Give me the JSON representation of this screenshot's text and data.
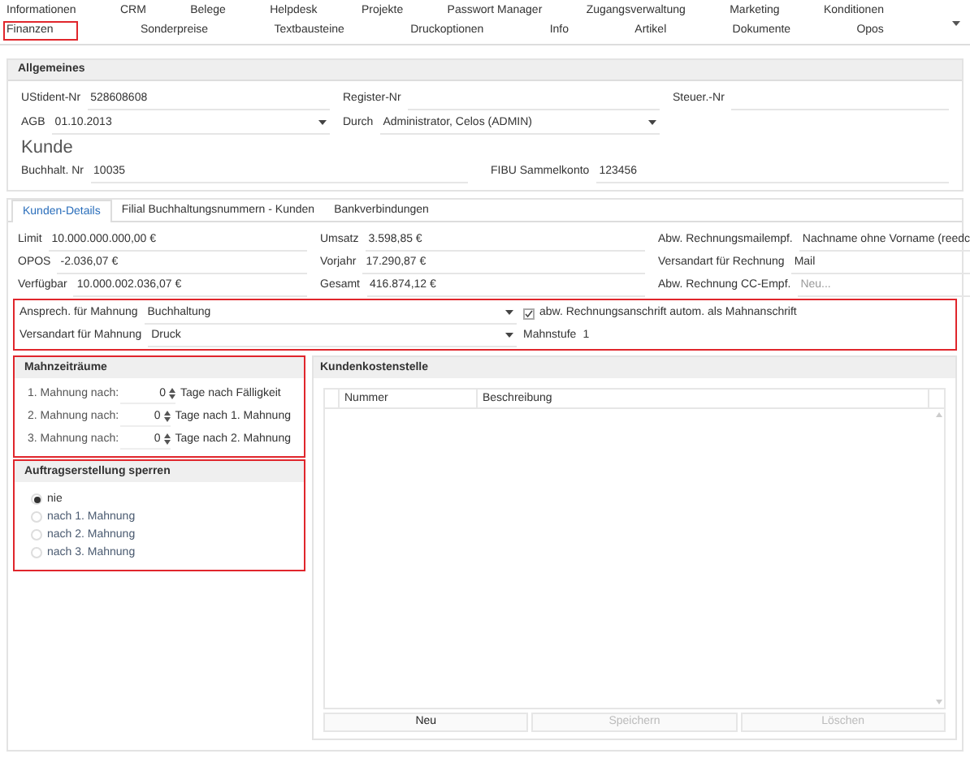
{
  "nav_tabs": [
    [
      {
        "label": "Informationen",
        "selected": false
      },
      {
        "label": "CRM",
        "selected": false
      },
      {
        "label": "Belege",
        "selected": false
      },
      {
        "label": "Helpdesk",
        "selected": false
      },
      {
        "label": "Projekte",
        "selected": false
      },
      {
        "label": "Passwort Manager",
        "selected": false
      },
      {
        "label": "Zugangsverwaltung",
        "selected": false
      },
      {
        "label": "Marketing",
        "selected": false
      },
      {
        "label": "Konditionen",
        "selected": false
      }
    ],
    [
      {
        "label": "Finanzen",
        "selected": true
      },
      {
        "label": "Sonderpreise",
        "selected": false
      },
      {
        "label": "Textbausteine",
        "selected": false
      },
      {
        "label": "Druckoptionen",
        "selected": false
      },
      {
        "label": "Info",
        "selected": false
      },
      {
        "label": "Artikel",
        "selected": false
      },
      {
        "label": "Dokumente",
        "selected": false
      },
      {
        "label": "Opos",
        "selected": false
      }
    ]
  ],
  "general": {
    "title": "Allgemeines",
    "rows": [
      [
        {
          "label": "UStident-Nr",
          "value": "528608608",
          "kind": "text"
        },
        {
          "label": "Register-Nr",
          "kind": "text"
        },
        {
          "label": "Steuer.-Nr",
          "kind": "text"
        }
      ],
      [
        {
          "label": "AGB",
          "value": "01.10.2013",
          "kind": "dropdown"
        },
        {
          "label": "Durch",
          "value": "Administrator, Celos (ADMIN)",
          "kind": "dropdown"
        }
      ]
    ],
    "heading": "Kunde",
    "bookkeeping": [
      {
        "label": "Buchhalt. Nr",
        "value": "10035",
        "kind": "text"
      },
      {
        "label": "FIBU Sammelkonto",
        "value": "123456",
        "kind": "text"
      }
    ]
  },
  "detail_tabs": [
    {
      "label": "Kunden-Details",
      "selected": true
    },
    {
      "label": "Filial Buchhaltungsnummern - Kunden",
      "selected": false
    },
    {
      "label": "Bankverbindungen",
      "selected": false
    }
  ],
  "details": [
    [
      {
        "label": "Limit",
        "value": "10.000.000.000,00 €",
        "kind": "text"
      },
      {
        "label": "OPOS",
        "value": "-2.036,07 €",
        "kind": "text"
      },
      {
        "label": "Verfügbar",
        "value": "10.000.002.036,07 €",
        "kind": "text"
      }
    ],
    [
      {
        "label": "Umsatz",
        "value": "3.598,85 €",
        "kind": "text"
      },
      {
        "label": "Vorjahr",
        "value": "17.290,87 €",
        "kind": "text"
      },
      {
        "label": "Gesamt",
        "value": "416.874,12 €",
        "kind": "text"
      }
    ],
    [
      {
        "label": "Abw. Rechnungsmailempf.",
        "value": "Nachname ohne Vorname (reedc",
        "kind": "dropdown"
      },
      {
        "label": "Versandart für Rechnung",
        "value": "Mail",
        "kind": "dropdown"
      },
      {
        "label": "Abw. Rechnung CC-Empf.",
        "placeholder": "Neu...",
        "kind": "dropdown"
      }
    ]
  ],
  "dunning": {
    "contact": {
      "label": "Ansprech. für Mahnung",
      "value": "Buchhaltung",
      "kind": "dropdown"
    },
    "checkbox": {
      "label": "abw. Rechnungsanschrift autom. als Mahnanschrift",
      "checked": true
    },
    "shipping": {
      "label": "Versandart für Mahnung",
      "value": "Druck",
      "kind": "dropdown"
    },
    "level": {
      "label": "Mahnstufe",
      "value": "1"
    }
  },
  "periods": {
    "title": "Mahnzeiträume",
    "rows": [
      {
        "label": "1. Mahnung nach:",
        "value": "0",
        "suffix": "Tage nach Fälligkeit"
      },
      {
        "label": "2. Mahnung nach:",
        "value": "0",
        "suffix": "Tage nach 1. Mahnung"
      },
      {
        "label": "3. Mahnung nach:",
        "value": "0",
        "suffix": "Tage nach 2. Mahnung"
      }
    ]
  },
  "block_orders": {
    "title": "Auftragserstellung sperren",
    "options": [
      {
        "label": "nie",
        "selected": true
      },
      {
        "label": "nach 1. Mahnung",
        "selected": false
      },
      {
        "label": "nach 2. Mahnung",
        "selected": false
      },
      {
        "label": "nach 3. Mahnung",
        "selected": false
      }
    ]
  },
  "cost_center": {
    "title": "Kundenkostenstelle",
    "columns": [
      "Nummer",
      "Beschreibung"
    ],
    "buttons": [
      {
        "label": "Neu",
        "disabled": false
      },
      {
        "label": "Speichern",
        "disabled": true
      },
      {
        "label": "Löschen",
        "disabled": true
      }
    ]
  }
}
